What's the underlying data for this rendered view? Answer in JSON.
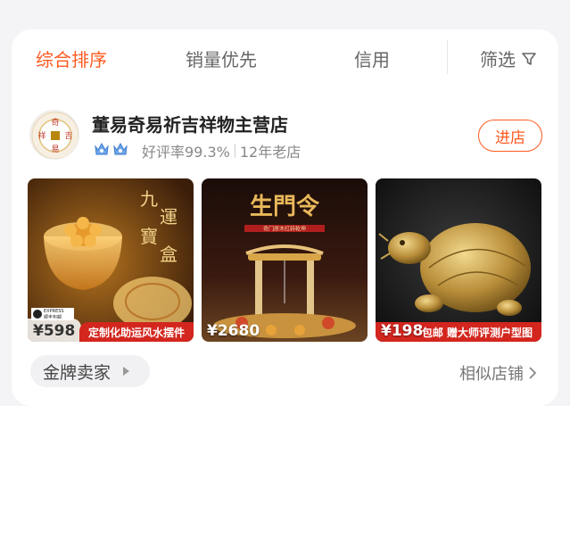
{
  "sort_bar": {
    "tabs": [
      {
        "label": "综合排序",
        "active": true
      },
      {
        "label": "销量优先",
        "active": false
      },
      {
        "label": "信用",
        "active": false
      }
    ],
    "filter_label": "筛选"
  },
  "store": {
    "name": "董易奇易祈吉祥物主营店",
    "rating_text": "好评率99.3%",
    "age_text": "12年老店",
    "enter_label": "进店",
    "logo_chars": [
      "祥",
      "吉",
      "易",
      "奇"
    ]
  },
  "products": [
    {
      "price": "¥598",
      "promo": "定制化助运风水摆件",
      "sf_top": "EXPRESS",
      "sf_bottom": "顺丰包邮",
      "art_text": [
        "九",
        "運",
        "寶",
        "盒"
      ]
    },
    {
      "price": "¥2680",
      "promo": "",
      "art_title": "生門令",
      "art_sub": "奇门原木红转乾坤"
    },
    {
      "price": "¥198",
      "promo": "包邮  赠大师评测户型图",
      "promo_prefix": "包邮"
    }
  ],
  "gold_seller_label": "金牌卖家",
  "similar_label": "相似店铺",
  "colors": {
    "accent": "#ff5a1f",
    "promo_red": "#d3261e"
  }
}
